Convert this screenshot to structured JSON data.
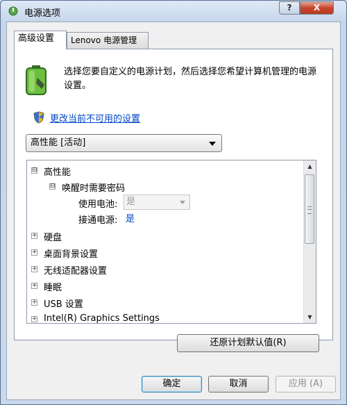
{
  "window": {
    "title": "电源选项",
    "help_label": "?",
    "close_label": "X"
  },
  "tabs": [
    {
      "label": "高级设置"
    },
    {
      "label": "Lenovo 电源管理"
    }
  ],
  "description": "选择您要自定义的电源计划，然后选择您希望计算机管理的电源设置。",
  "change_link": "更改当前不可用的设置",
  "plan_select": {
    "value": "高性能 [活动]"
  },
  "tree": {
    "plan": {
      "label": "高性能",
      "expander": "⊟"
    },
    "wake_password": {
      "label": "唤醒时需要密码",
      "expander": "⊟"
    },
    "on_battery": {
      "label": "使用电池:",
      "value": "是"
    },
    "plugged_in": {
      "label": "接通电源:",
      "value": "是"
    },
    "items": [
      {
        "label": "硬盘",
        "expander": "+"
      },
      {
        "label": "桌面背景设置",
        "expander": "+"
      },
      {
        "label": "无线适配器设置",
        "expander": "+"
      },
      {
        "label": "睡眠",
        "expander": "+"
      },
      {
        "label": "USB 设置",
        "expander": "+"
      },
      {
        "label": "Intel(R) Graphics Settings",
        "expander": "+"
      }
    ]
  },
  "restore_button": "还原计划默认值(R)",
  "buttons": {
    "ok": "确定",
    "cancel": "取消",
    "apply": "应用 (A)"
  }
}
